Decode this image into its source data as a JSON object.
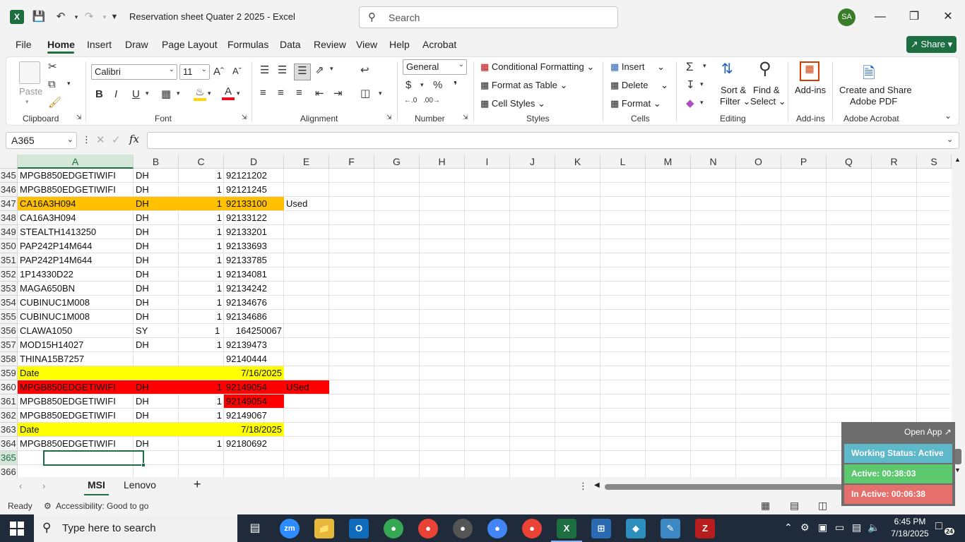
{
  "window": {
    "title": "Reservation sheet Quater 2 2025  -  Excel",
    "search_placeholder": "Search",
    "avatar": "SA"
  },
  "menu": {
    "tabs": [
      "File",
      "Home",
      "Insert",
      "Draw",
      "Page Layout",
      "Formulas",
      "Data",
      "Review",
      "View",
      "Help",
      "Acrobat"
    ],
    "share": "Share"
  },
  "ribbon": {
    "clipboard": {
      "label": "Clipboard",
      "paste": "Paste"
    },
    "font": {
      "label": "Font",
      "name": "Calibri",
      "size": "11"
    },
    "alignment": {
      "label": "Alignment"
    },
    "number": {
      "label": "Number",
      "format": "General"
    },
    "styles": {
      "label": "Styles",
      "conditional": "Conditional Formatting",
      "format_table": "Format as Table",
      "cell_styles": "Cell Styles"
    },
    "cells": {
      "label": "Cells",
      "insert": "Insert",
      "delete": "Delete",
      "format": "Format"
    },
    "editing": {
      "label": "Editing",
      "sort1": "Sort &",
      "sort2": "Filter",
      "find1": "Find &",
      "find2": "Select"
    },
    "addins": {
      "label": "Add-ins",
      "btn": "Add-ins"
    },
    "acrobat": {
      "label": "Adobe Acrobat",
      "btn1": "Create and Share",
      "btn2": "Adobe PDF"
    }
  },
  "formula_bar": {
    "name_box": "A365",
    "fx": "fx",
    "value": ""
  },
  "columns": [
    "A",
    "B",
    "C",
    "D",
    "E",
    "F",
    "G",
    "H",
    "I",
    "J",
    "K",
    "L",
    "M",
    "N",
    "O",
    "P",
    "Q",
    "R",
    "S"
  ],
  "rows": [
    {
      "n": "345",
      "a": "MPGB850EDGETIWIFI",
      "b": "DH",
      "c": "1",
      "d": "92121202",
      "e": "",
      "fill": ""
    },
    {
      "n": "346",
      "a": "MPGB850EDGETIWIFI",
      "b": "DH",
      "c": "1",
      "d": "92121245",
      "e": "",
      "fill": ""
    },
    {
      "n": "347",
      "a": "CA16A3H094",
      "b": "DH",
      "c": "1",
      "d": "92133100",
      "e": "Used",
      "fill": "orange"
    },
    {
      "n": "348",
      "a": "CA16A3H094",
      "b": "DH",
      "c": "1",
      "d": "92133122",
      "e": "",
      "fill": ""
    },
    {
      "n": "349",
      "a": "STEALTH1413250",
      "b": "DH",
      "c": "1",
      "d": "92133201",
      "e": "",
      "fill": ""
    },
    {
      "n": "350",
      "a": "PAP242P14M644",
      "b": "DH",
      "c": "1",
      "d": "92133693",
      "e": "",
      "fill": ""
    },
    {
      "n": "351",
      "a": "PAP242P14M644",
      "b": "DH",
      "c": "1",
      "d": "92133785",
      "e": "",
      "fill": ""
    },
    {
      "n": "352",
      "a": "1P14330D22",
      "b": "DH",
      "c": "1",
      "d": "92134081",
      "e": "",
      "fill": ""
    },
    {
      "n": "353",
      "a": "MAGA650BN",
      "b": "DH",
      "c": "1",
      "d": "92134242",
      "e": "",
      "fill": ""
    },
    {
      "n": "354",
      "a": "CUBINUC1M008",
      "b": "DH",
      "c": "1",
      "d": "92134676",
      "e": "",
      "fill": ""
    },
    {
      "n": "355",
      "a": "CUBINUC1M008",
      "b": "DH",
      "c": "1",
      "d": "92134686",
      "e": "",
      "fill": ""
    },
    {
      "n": "356",
      "a": "CLAWA1050",
      "b": "SY",
      "c": "1",
      "d": "164250067",
      "e": "",
      "fill": "sy"
    },
    {
      "n": "357",
      "a": "MOD15H14027",
      "b": "DH",
      "c": "1",
      "d": "92139473",
      "e": "",
      "fill": ""
    },
    {
      "n": "358",
      "a": "THINA15B7257",
      "b": "",
      "c": "",
      "d": "92140444",
      "e": "",
      "fill": ""
    },
    {
      "n": "359",
      "a": "Date",
      "b": "",
      "c": "",
      "d": "7/16/2025",
      "e": "",
      "fill": "yellow"
    },
    {
      "n": "360",
      "a": "MPGB850EDGETIWIFI",
      "b": "DH",
      "c": "1",
      "d": "92149054",
      "e": "USed",
      "fill": "red"
    },
    {
      "n": "361",
      "a": "MPGB850EDGETIWIFI",
      "b": "DH",
      "c": "1",
      "d": "92149054",
      "e": "",
      "fill": "redD"
    },
    {
      "n": "362",
      "a": "MPGB850EDGETIWIFI",
      "b": "DH",
      "c": "1",
      "d": "92149067",
      "e": "",
      "fill": ""
    },
    {
      "n": "363",
      "a": "Date",
      "b": "",
      "c": "",
      "d": "7/18/2025",
      "e": "",
      "fill": "yellow"
    },
    {
      "n": "364",
      "a": "MPGB850EDGETIWIFI",
      "b": "DH",
      "c": "1",
      "d": "92180692",
      "e": "",
      "fill": ""
    },
    {
      "n": "365",
      "a": "",
      "b": "",
      "c": "",
      "d": "",
      "e": "",
      "fill": ""
    },
    {
      "n": "366",
      "a": "",
      "b": "",
      "c": "",
      "d": "",
      "e": "",
      "fill": ""
    }
  ],
  "sheets": {
    "tabs": [
      "MSI",
      "Lenovo"
    ],
    "add": "+"
  },
  "status": {
    "ready": "Ready",
    "accessibility": "Accessibility: Good to go"
  },
  "widget": {
    "open_app": "Open App",
    "working": "Working Status: Active",
    "active": "Active: 00:38:03",
    "inactive": "In Active: 00:06:38"
  },
  "taskbar": {
    "search_placeholder": "Type here to search",
    "time": "6:45 PM",
    "date": "7/18/2025",
    "notif": "24",
    "zoom_app": "zm"
  },
  "colors": {
    "accent": "#1d6f42",
    "orange": "#ffc000",
    "yellow": "#ffff00",
    "red": "#ff0000"
  }
}
